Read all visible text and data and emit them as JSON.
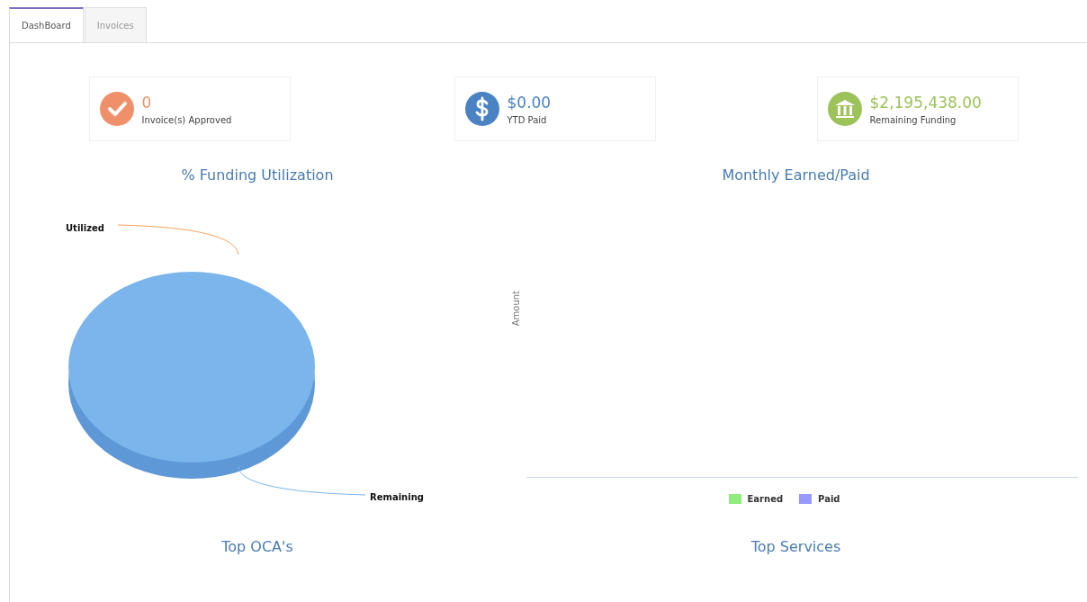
{
  "tabs": [
    {
      "label": "DashBoard",
      "selected": true
    },
    {
      "label": "Invoices",
      "selected": false
    }
  ],
  "stats": [
    {
      "kind": "approved",
      "value": "0",
      "label": "Invoice(s) Approved"
    },
    {
      "kind": "paid",
      "value": "$0.00",
      "label": "YTD Paid"
    },
    {
      "kind": "funding",
      "value": "$2,195,438.00",
      "label": "Remaining Funding"
    }
  ],
  "funding_chart": {
    "title": "% Funding Utilization",
    "labels": [
      {
        "text": "Utilized",
        "color": "#f7a35c"
      },
      {
        "text": "Remaining",
        "color": "#7cb5ec"
      }
    ]
  },
  "monthly_chart": {
    "title": "Monthly Earned/Paid",
    "ylabel": "Amount",
    "legend": [
      {
        "name": "Earned",
        "color": "#90ed7d"
      },
      {
        "name": "Paid",
        "color": "#9999ff"
      }
    ]
  },
  "bottom_titles": [
    "Top OCA's",
    "Top Services"
  ]
}
